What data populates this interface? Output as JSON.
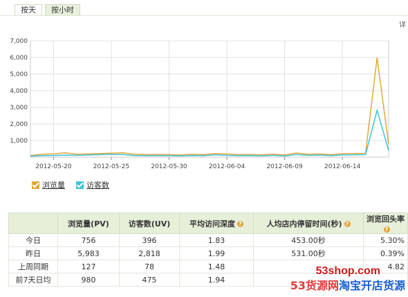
{
  "tabs": [
    {
      "label": "按天",
      "active": true
    },
    {
      "label": "按小时",
      "active": false
    }
  ],
  "corner_text": "详",
  "chart_data": {
    "type": "line",
    "x": [
      "2012-05-18",
      "2012-05-19",
      "2012-05-20",
      "2012-05-21",
      "2012-05-22",
      "2012-05-23",
      "2012-05-24",
      "2012-05-25",
      "2012-05-26",
      "2012-05-27",
      "2012-05-28",
      "2012-05-29",
      "2012-05-30",
      "2012-05-31",
      "2012-06-01",
      "2012-06-02",
      "2012-06-03",
      "2012-06-04",
      "2012-06-05",
      "2012-06-06",
      "2012-06-07",
      "2012-06-08",
      "2012-06-09",
      "2012-06-10",
      "2012-06-11",
      "2012-06-12",
      "2012-06-13",
      "2012-06-14",
      "2012-06-15",
      "2012-06-16",
      "2012-06-17",
      "2012-06-18"
    ],
    "x_tick_labels": [
      "2012-05-20",
      "2012-05-25",
      "2012-05-30",
      "2012-06-04",
      "2012-06-09",
      "2012-06-14"
    ],
    "ylim": [
      0,
      7000
    ],
    "y_ticks": [
      1000,
      2000,
      3000,
      4000,
      5000,
      6000,
      7000
    ],
    "y_tick_labels": [
      "1,000",
      "2,000",
      "3,000",
      "4,000",
      "5,000",
      "6,000",
      "7,000"
    ],
    "grid": true,
    "series": [
      {
        "name": "浏览量",
        "color": "#e0a83a",
        "values": [
          100,
          170,
          200,
          260,
          180,
          200,
          220,
          240,
          260,
          180,
          150,
          160,
          150,
          130,
          170,
          150,
          220,
          190,
          150,
          160,
          140,
          180,
          130,
          250,
          180,
          200,
          150,
          210,
          220,
          230,
          5983,
          756
        ]
      },
      {
        "name": "访客数",
        "color": "#3cc3d6",
        "values": [
          60,
          90,
          100,
          120,
          110,
          130,
          150,
          170,
          160,
          100,
          90,
          95,
          90,
          80,
          100,
          90,
          140,
          110,
          90,
          100,
          80,
          110,
          70,
          160,
          110,
          120,
          90,
          130,
          140,
          150,
          2818,
          396
        ]
      }
    ]
  },
  "legend": [
    {
      "label": "浏览量",
      "color": "#e0a83a"
    },
    {
      "label": "访客数",
      "color": "#3cc3d6"
    }
  ],
  "table": {
    "headers": [
      "",
      "浏览量(PV)",
      "访客数(UV)",
      "平均访问深度",
      "人均店内停留时间(秒)",
      "浏览回头率"
    ],
    "rows": [
      [
        "今日",
        "756",
        "396",
        "1.83",
        "453.00秒",
        "5.30%"
      ],
      [
        "昨日",
        "5,983",
        "2,818",
        "1.99",
        "531.00秒",
        "0.39%"
      ],
      [
        "上周同期",
        "127",
        "78",
        "1.48",
        "",
        "4.82"
      ],
      [
        "前7天日均",
        "980",
        "475",
        "1.94",
        "",
        ""
      ]
    ]
  },
  "watermark": {
    "top": "53shop.com",
    "part1": "53货源网",
    "part2": "淘宝开店货源"
  }
}
